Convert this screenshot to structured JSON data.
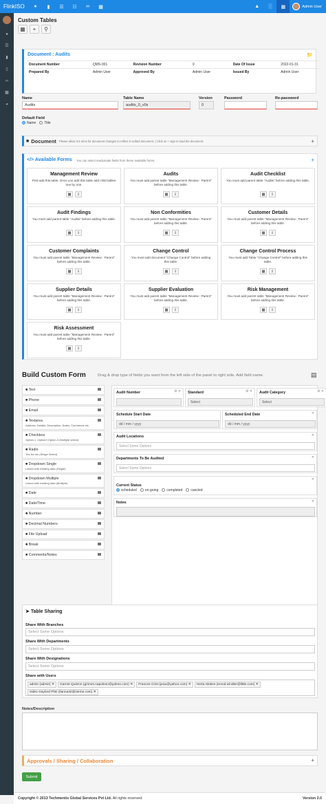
{
  "app": {
    "brand": "FlinkISO",
    "user_name": "Admin User"
  },
  "topbar": {
    "icons": [
      "dashboard-icon",
      "bookmark-icon",
      "list-icon",
      "list-alt-icon",
      "link-icon",
      "database-icon"
    ],
    "right_icons": [
      "upload-icon",
      "chart-icon",
      "table-icon"
    ]
  },
  "sidebar": {
    "icons": [
      "dashboard-icon",
      "list-icon",
      "bookmark-icon",
      "folder-icon",
      "link-icon",
      "database-icon",
      "pie-icon"
    ]
  },
  "page": {
    "title": "Custom Tables"
  },
  "doc_header": {
    "title": "Document : Audits",
    "rows": [
      [
        "Document Number",
        "QMS-001",
        "Revision Number",
        "0",
        "Date Of Issue",
        "2022-01-31"
      ],
      [
        "Prepared By",
        "Admin User",
        "Approved By",
        "Admin User",
        "Issued By",
        "Admin User"
      ]
    ]
  },
  "form": {
    "name_label": "Name",
    "name_value": "Audits",
    "table_name_label": "Table Name",
    "table_name_value": "audits_0_v0s",
    "version_label": "Version",
    "version_value": "0",
    "password_label": "Password",
    "repassword_label": "Re-password",
    "default_field_label": "Default Field",
    "opt_name": "Name",
    "opt_title": "Title"
  },
  "document_bar": {
    "title": "Document",
    "hint": "Please allow 3-5 mins for document changes to reflect in edited document. | Click on + sign to load the document."
  },
  "available_forms": {
    "title": "Available Forms",
    "subtitle": "You can select readymade fields from these available forms.",
    "cards": [
      {
        "title": "Management Review",
        "desc": "First add this table. Once you add this table add child tables one by one."
      },
      {
        "title": "Audits",
        "desc": "You must add parent table \"Management Review : Parent\" before adding this table."
      },
      {
        "title": "Audit Checklist",
        "desc": "You must add parent table \"Audits\" before adding this table."
      },
      {
        "title": "Audit Findings",
        "desc": "You must add parent table \"Audits\" before adding this table."
      },
      {
        "title": "Non Conformities",
        "desc": "You must add parent table \"Management Review : Parent\" before adding this table."
      },
      {
        "title": "Customer Details",
        "desc": "You must add parent table \"Management Review : Parent\" before adding this table."
      },
      {
        "title": "Customer Complaints",
        "desc": "You must add parent table \"Management Review : Parent\" before adding this table."
      },
      {
        "title": "Change Control",
        "desc": "You must add document \"Change Control\" before adding this table."
      },
      {
        "title": "Change Control Process",
        "desc": "You must add Table \"Change Control\" before adding this table."
      },
      {
        "title": "Supplier Details",
        "desc": "You must add parent table \"Management Review : Parent\" before adding this table."
      },
      {
        "title": "Supplier Evaluation",
        "desc": "You must add parent table \"Management Review : Parent\" before adding this table."
      },
      {
        "title": "Risk Management",
        "desc": "You must add parent table \"Management Review : Parent\" before adding this table."
      },
      {
        "title": "Risk Assessment",
        "desc": "You must add parent table \"Management Review : Parent\" before adding this table."
      }
    ]
  },
  "builder": {
    "title": "Build Custom Form",
    "subtitle": "Drag & drop type of fields you want from the left side of the panel to right side. Add field name.",
    "palette": [
      {
        "label": "Text",
        "sub": "",
        "icon": "text-icon"
      },
      {
        "label": "Phone",
        "sub": "",
        "icon": "phone-icon"
      },
      {
        "label": "Email",
        "sub": "",
        "icon": "email-icon"
      },
      {
        "label": "Textarea",
        "sub": "Address, Details, Description, Notes, Comments etc",
        "icon": "textarea-icon"
      },
      {
        "label": "Checkbox",
        "sub": "Option-1 ,Option2,Option-3 (Multiple select)",
        "icon": "checkbox-icon"
      },
      {
        "label": "Radio",
        "sub": "Yes,No etc (Sinlge Select)",
        "icon": "radio-icon"
      },
      {
        "label": "Dropdown Single",
        "sub": "Linked with existing data (Single)",
        "icon": "dropdown-icon"
      },
      {
        "label": "Dropdown Multiple",
        "sub": "Linked with existing data (Multiple)",
        "icon": "dropdown-icon"
      },
      {
        "label": "Date",
        "sub": "",
        "icon": "calendar-icon"
      },
      {
        "label": "Date/Time",
        "sub": "",
        "icon": "clock-icon"
      },
      {
        "label": "Number",
        "sub": "",
        "icon": "number-icon"
      },
      {
        "label": "Decimal Numbers",
        "sub": "",
        "icon": "decimal-icon"
      },
      {
        "label": "File Upload",
        "sub": "",
        "icon": "file-icon"
      },
      {
        "label": "Break",
        "sub": "",
        "icon": "break-icon"
      },
      {
        "label": "Comments/Notes",
        "sub": "",
        "icon": "comment-icon"
      }
    ],
    "fields": {
      "audit_number": "Audit Number",
      "standard": "Standard",
      "standard_value": "Select",
      "audit_category": "Audit Category",
      "audit_category_value": "Select",
      "schedule_start": "Schedule Start Date",
      "schedule_start_ph": "dd / mm / yyyy",
      "schedule_end": "Scheduled End Date",
      "schedule_end_ph": "dd / mm / yyyy",
      "audit_locations": "Audit Locations",
      "locations_ph": "Select Some Options",
      "departments": "Departments To Be Audited",
      "departments_ph": "Select Some Options",
      "current_status": "Current Status",
      "status_options": [
        "scheduled",
        "on-going",
        "completed",
        "cancled"
      ],
      "notes": "Notes"
    }
  },
  "sharing": {
    "title": "Table Sharing",
    "branches_label": "Share With Branches",
    "branches_ph": "Select Some Options",
    "departments_label": "Share With Departments",
    "departments_ph": "Select Some Options",
    "designations_label": "Share With Designations",
    "designations_ph": "Select Some Options",
    "users_label": "Share with Users",
    "users": [
      "admin (admin)",
      "Garnet Quitzon (grimes.napoleon@yahoo.com)",
      "Frances Crist (prau@yahoo.com)",
      "Herta Stokes (emod.windler@little.com)",
      "Isidro Gaylord PhD (lianna32@zieme.com)"
    ]
  },
  "notes_label": "Notes/Description",
  "approvals": {
    "title": "Approvals / Sharing / Collaboration"
  },
  "submit_label": "Submit",
  "footer": {
    "copyright": "Copyright © 2013 Techmentis Global Services Pvt Ltd.",
    "rights": "All rights reserved.",
    "version": "Version 2.0"
  }
}
